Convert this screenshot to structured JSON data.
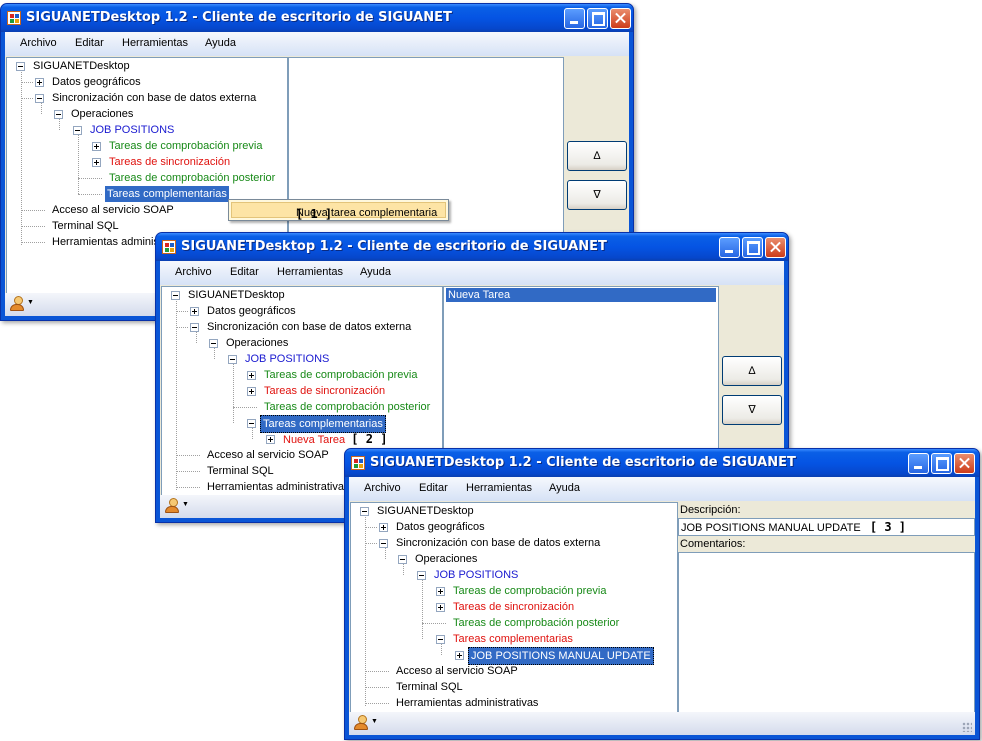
{
  "app": {
    "title": "SIGUANETDesktop 1.2 - Cliente de escritorio de SIGUANET"
  },
  "menu": [
    "Archivo",
    "Editar",
    "Herramientas",
    "Ayuda"
  ],
  "tree": {
    "root": "SIGUANETDesktop",
    "datos": "Datos geográficos",
    "sync": "Sincronización con base de datos externa",
    "operaciones": "Operaciones",
    "job": "JOB POSITIONS",
    "previa": "Tareas de comprobación previa",
    "sincronizacion": "Tareas de sincronización",
    "posterior": "Tareas de comprobación posterior",
    "complementarias": "Tareas complementarias",
    "soap": "Acceso al servicio SOAP",
    "sql": "Terminal SQL",
    "herr": "Herramientas administrativas",
    "herr_truncated": "Herramientas administ"
  },
  "window1": {
    "context_menu_item": "Nueva tarea complementaria",
    "annotation": "[ 1 ]",
    "up_button": "∆",
    "down_button": "∇"
  },
  "window2": {
    "new_task": "Nueva Tarea",
    "annotation": "[ 2 ]",
    "list_item": "Nueva Tarea",
    "up_button": "∆",
    "down_button": "∇"
  },
  "window3": {
    "task": "JOB POSITIONS MANUAL UPDATE",
    "descripcion_label": "Descripción:",
    "descripcion_value": "JOB POSITIONS MANUAL UPDATE",
    "annotation": "[ 3 ]",
    "comentarios_label": "Comentarios:",
    "comentarios_value": ""
  },
  "colors": {
    "titlebar": "#0554e3",
    "selection": "#316ac5",
    "green_label": "#188a18",
    "red_label": "#e0120e",
    "blue_label": "#1a1ad0"
  },
  "icons": [
    "app-icon",
    "minimize-icon",
    "maximize-icon",
    "close-icon",
    "user-icon",
    "dropdown-arrow-icon"
  ]
}
